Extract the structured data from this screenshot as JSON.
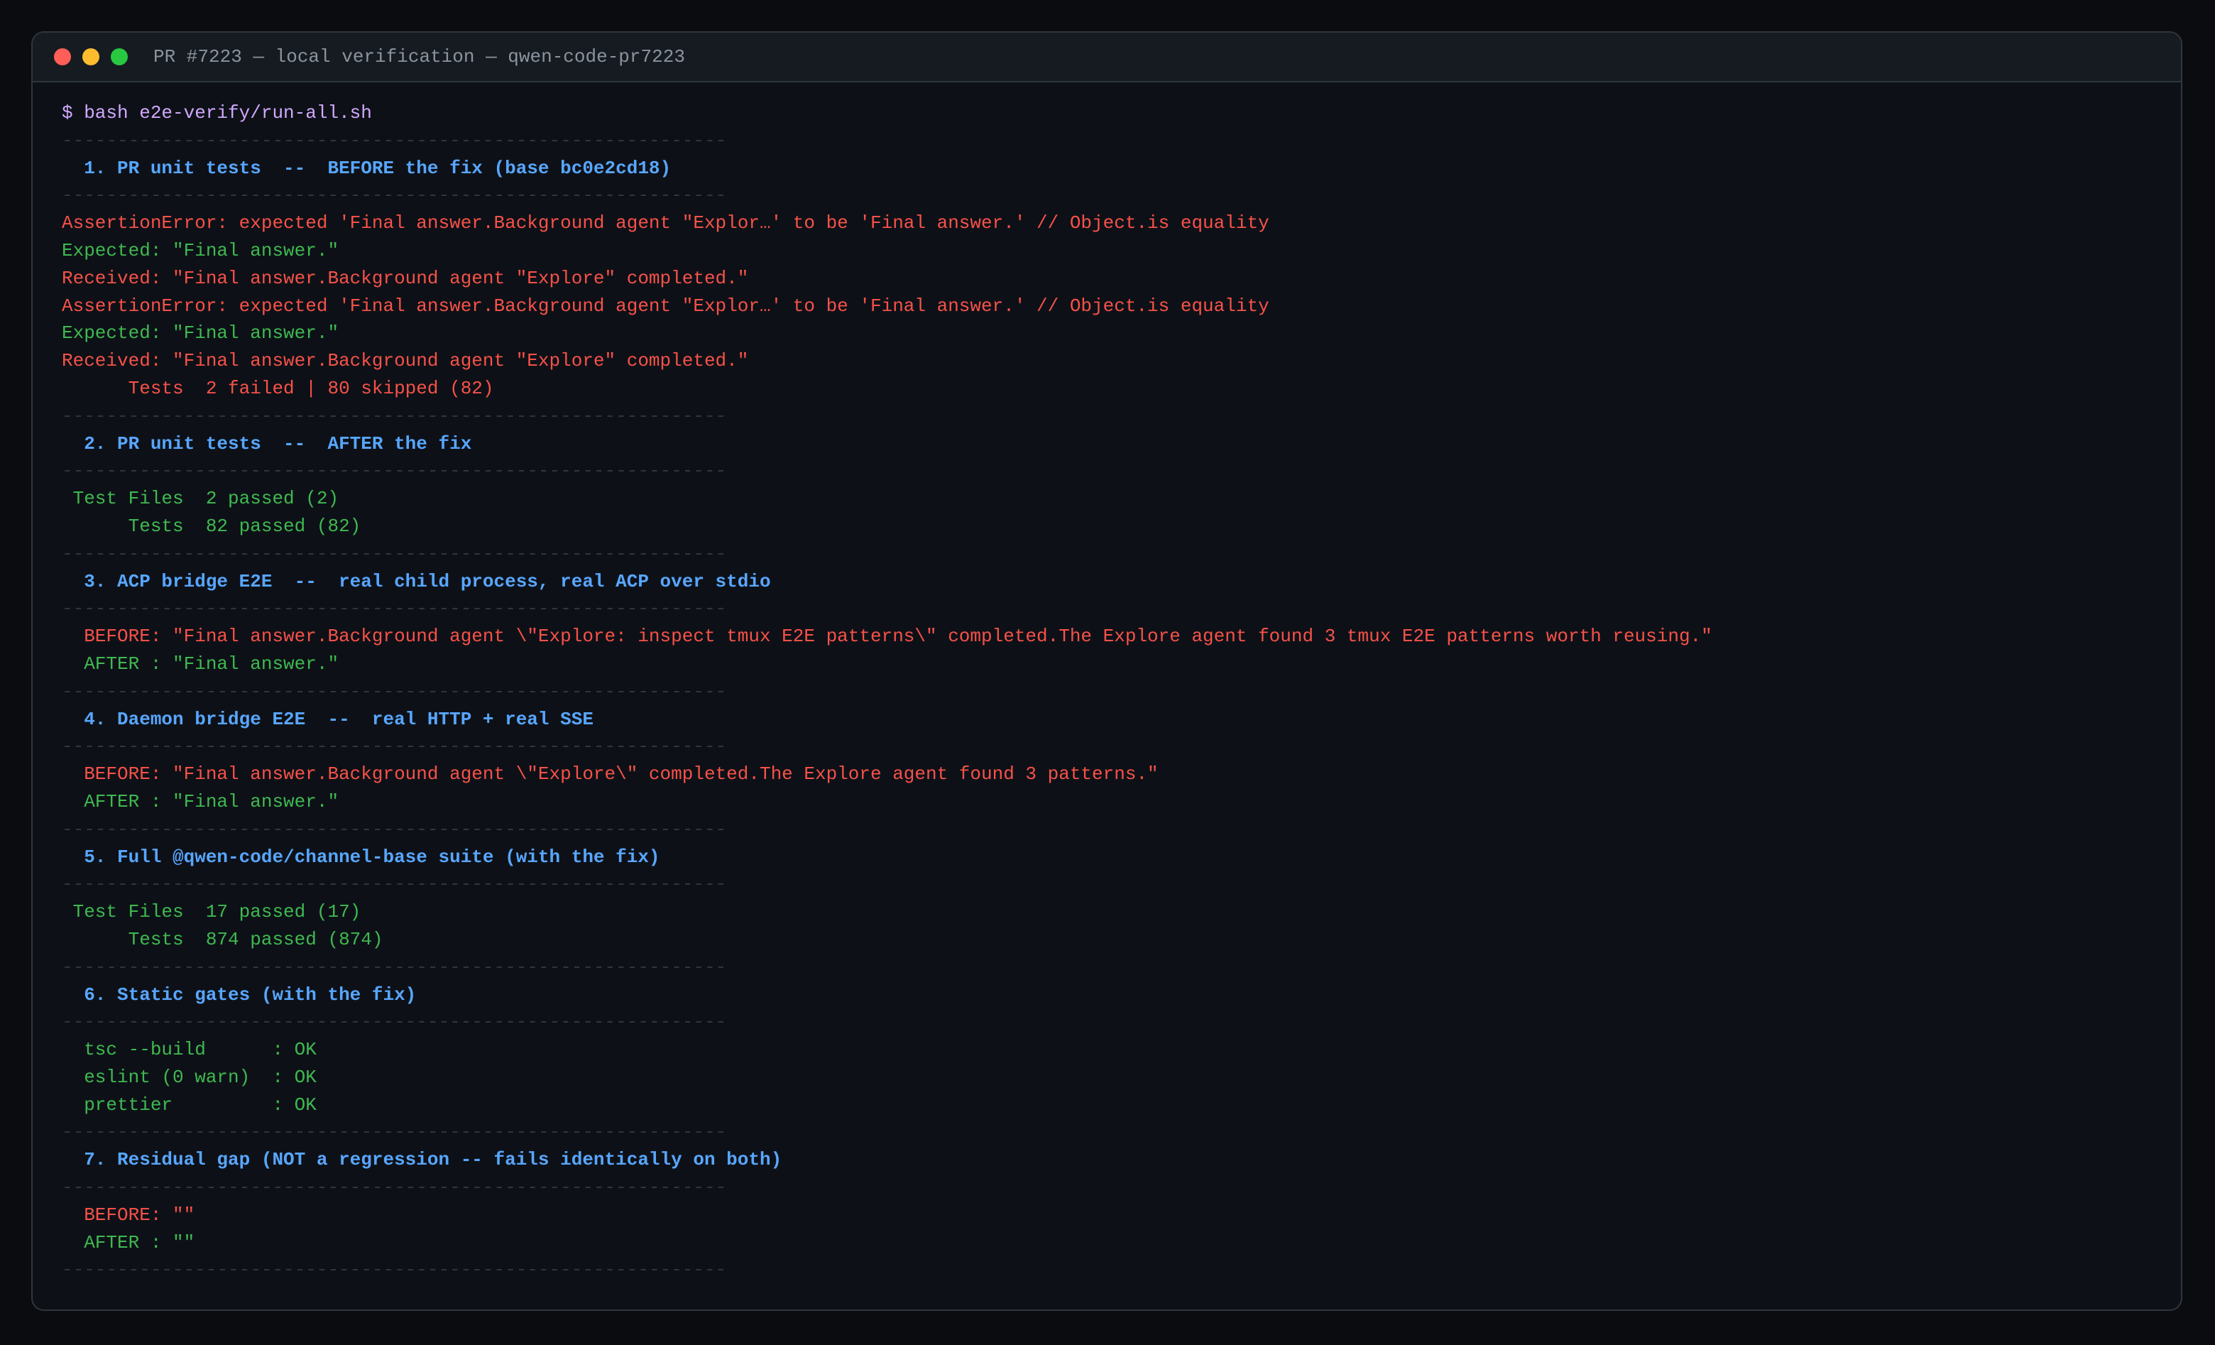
{
  "window": {
    "title": "PR #7223 — local verification — qwen-code-pr7223",
    "controls": {
      "close_color": "#ff5f57",
      "minimize_color": "#febc2e",
      "maximize_color": "#28c840"
    }
  },
  "colors": {
    "background": "#0d1117",
    "header": "#58a6ff",
    "fail": "#f85149",
    "pass": "#3fb950",
    "prompt": "#d2a8ff",
    "separator": "#30363d"
  },
  "terminal": {
    "lines": [
      {
        "type": "command",
        "text": "$ bash e2e-verify/run-all.sh"
      },
      {
        "type": "separator",
        "text": "------------------------------------------------------------"
      },
      {
        "type": "header",
        "text": "  1. PR unit tests  --  BEFORE the fix (base bc0e2cd18)"
      },
      {
        "type": "separator",
        "text": "------------------------------------------------------------"
      },
      {
        "type": "fail",
        "text": "AssertionError: expected 'Final answer.Background agent \"Explor…' to be 'Final answer.' // Object.is equality"
      },
      {
        "type": "pass",
        "text": "Expected: \"Final answer.\""
      },
      {
        "type": "fail",
        "text": "Received: \"Final answer.Background agent \"Explore\" completed.\""
      },
      {
        "type": "fail",
        "text": "AssertionError: expected 'Final answer.Background agent \"Explor…' to be 'Final answer.' // Object.is equality"
      },
      {
        "type": "pass",
        "text": "Expected: \"Final answer.\""
      },
      {
        "type": "fail",
        "text": "Received: \"Final answer.Background agent \"Explore\" completed.\""
      },
      {
        "type": "fail",
        "text": "      Tests  2 failed | 80 skipped (82)"
      },
      {
        "type": "separator",
        "text": "------------------------------------------------------------"
      },
      {
        "type": "header",
        "text": "  2. PR unit tests  --  AFTER the fix"
      },
      {
        "type": "separator",
        "text": "------------------------------------------------------------"
      },
      {
        "type": "pass",
        "text": " Test Files  2 passed (2)"
      },
      {
        "type": "pass",
        "text": "      Tests  82 passed (82)"
      },
      {
        "type": "separator",
        "text": "------------------------------------------------------------"
      },
      {
        "type": "header",
        "text": "  3. ACP bridge E2E  --  real child process, real ACP over stdio"
      },
      {
        "type": "separator",
        "text": "------------------------------------------------------------"
      },
      {
        "type": "fail",
        "text": "  BEFORE: \"Final answer.Background agent \\\"Explore: inspect tmux E2E patterns\\\" completed.The Explore agent found 3 tmux E2E patterns worth reusing.\""
      },
      {
        "type": "pass",
        "text": "  AFTER : \"Final answer.\""
      },
      {
        "type": "separator",
        "text": "------------------------------------------------------------"
      },
      {
        "type": "header",
        "text": "  4. Daemon bridge E2E  --  real HTTP + real SSE"
      },
      {
        "type": "separator",
        "text": "------------------------------------------------------------"
      },
      {
        "type": "fail",
        "text": "  BEFORE: \"Final answer.Background agent \\\"Explore\\\" completed.The Explore agent found 3 patterns.\""
      },
      {
        "type": "pass",
        "text": "  AFTER : \"Final answer.\""
      },
      {
        "type": "separator",
        "text": "------------------------------------------------------------"
      },
      {
        "type": "header",
        "text": "  5. Full @qwen-code/channel-base suite (with the fix)"
      },
      {
        "type": "separator",
        "text": "------------------------------------------------------------"
      },
      {
        "type": "pass",
        "text": " Test Files  17 passed (17)"
      },
      {
        "type": "pass",
        "text": "      Tests  874 passed (874)"
      },
      {
        "type": "separator",
        "text": "------------------------------------------------------------"
      },
      {
        "type": "header",
        "text": "  6. Static gates (with the fix)"
      },
      {
        "type": "separator",
        "text": "------------------------------------------------------------"
      },
      {
        "type": "pass",
        "text": "  tsc --build      : OK"
      },
      {
        "type": "pass",
        "text": "  eslint (0 warn)  : OK"
      },
      {
        "type": "pass",
        "text": "  prettier         : OK"
      },
      {
        "type": "separator",
        "text": "------------------------------------------------------------"
      },
      {
        "type": "header",
        "text": "  7. Residual gap (NOT a regression -- fails identically on both)"
      },
      {
        "type": "separator",
        "text": "------------------------------------------------------------"
      },
      {
        "type": "fail",
        "text": "  BEFORE: \"\""
      },
      {
        "type": "pass",
        "text": "  AFTER : \"\""
      },
      {
        "type": "separator",
        "text": "------------------------------------------------------------"
      }
    ]
  }
}
